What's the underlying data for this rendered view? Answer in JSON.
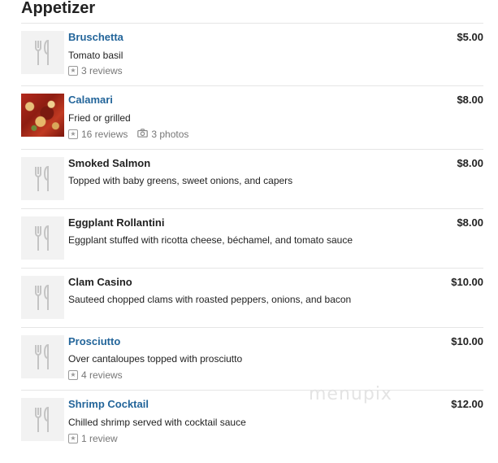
{
  "section": {
    "title": "Appetizer"
  },
  "items": [
    {
      "name": "Bruschetta",
      "description": "Tomato basil",
      "price": "$5.00",
      "reviews": "3 reviews",
      "photos": ""
    },
    {
      "name": "Calamari",
      "description": "Fried or grilled",
      "price": "$8.00",
      "reviews": "16 reviews",
      "photos": "3 photos"
    },
    {
      "name": "Smoked Salmon",
      "description": "Topped with baby greens, sweet onions, and capers",
      "price": "$8.00",
      "reviews": "",
      "photos": ""
    },
    {
      "name": "Eggplant Rollantini",
      "description": "Eggplant stuffed with ricotta cheese, béchamel, and tomato sauce",
      "price": "$8.00",
      "reviews": "",
      "photos": ""
    },
    {
      "name": "Clam Casino",
      "description": "Sauteed chopped clams with roasted peppers, onions, and bacon",
      "price": "$10.00",
      "reviews": "",
      "photos": ""
    },
    {
      "name": "Prosciutto",
      "description": "Over cantaloupes topped with prosciutto",
      "price": "$10.00",
      "reviews": "4 reviews",
      "photos": ""
    },
    {
      "name": "Shrimp Cocktail",
      "description": "Chilled shrimp served with cocktail sauce",
      "price": "$12.00",
      "reviews": "1 review",
      "photos": ""
    }
  ],
  "watermark": "menupix",
  "icons": {
    "thumbnail_placeholder": "fork-knife-icon",
    "review": "star-icon",
    "photo": "camera-icon"
  },
  "colors": {
    "link": "#23659a",
    "meta": "#777777",
    "divider": "#e5e5e5",
    "thumb_bg": "#f2f2f2"
  }
}
